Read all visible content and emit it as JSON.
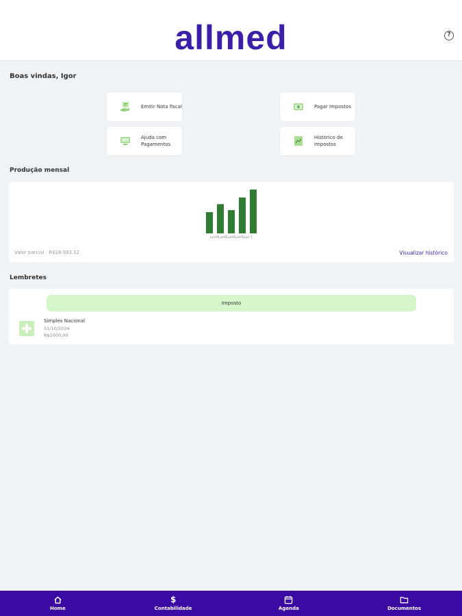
{
  "header": {
    "logo_text": "allmed",
    "help_icon": "question-circle-icon",
    "help_glyph": "?"
  },
  "welcome": "Boas vindas, Igor",
  "actions": [
    {
      "label": "Emitir Nota fiscal",
      "icon": "invoice-hand-icon"
    },
    {
      "label": "Pagar Impostos",
      "icon": "pay-taxes-icon"
    },
    {
      "label": "Ajuda com Pagamentos",
      "icon": "payment-help-icon"
    },
    {
      "label": "Histórico de Impostos",
      "icon": "tax-history-icon"
    }
  ],
  "production": {
    "title": "Produção mensal",
    "partial_value": "Valor parcial : R$18.993,12",
    "history_link": "Visualizar histórico"
  },
  "chart_data": {
    "type": "bar",
    "categories": [
      "Lun",
      "Lun",
      "Lun",
      "Lun",
      "Lun"
    ],
    "category_axis_text": "Lun0Lun0Lun0Lun0Lun 1",
    "values": [
      32,
      44,
      35,
      54,
      66
    ],
    "ylim": [
      0,
      70
    ],
    "bar_color": "#2e7d32",
    "grid": false,
    "title": "",
    "xlabel": "",
    "ylabel": ""
  },
  "reminders": {
    "title": "Lembretes",
    "tag": "Imposto",
    "item": {
      "name": "Simples Nacional",
      "date": "01/10/2024",
      "value": "R$1000,00",
      "icon": "plus-icon"
    }
  },
  "nav": [
    {
      "label": "Home",
      "icon": "home-icon"
    },
    {
      "label": "Contabilidade",
      "icon": "dollar-icon",
      "glyph": "$"
    },
    {
      "label": "Agenda",
      "icon": "calendar-icon"
    },
    {
      "label": "Documentos",
      "icon": "folder-icon"
    }
  ],
  "colors": {
    "brand": "#3b1fa8",
    "nav_bg": "#3b0aa3",
    "accent_green": "#d4f6c9",
    "bar": "#2e7d32"
  }
}
